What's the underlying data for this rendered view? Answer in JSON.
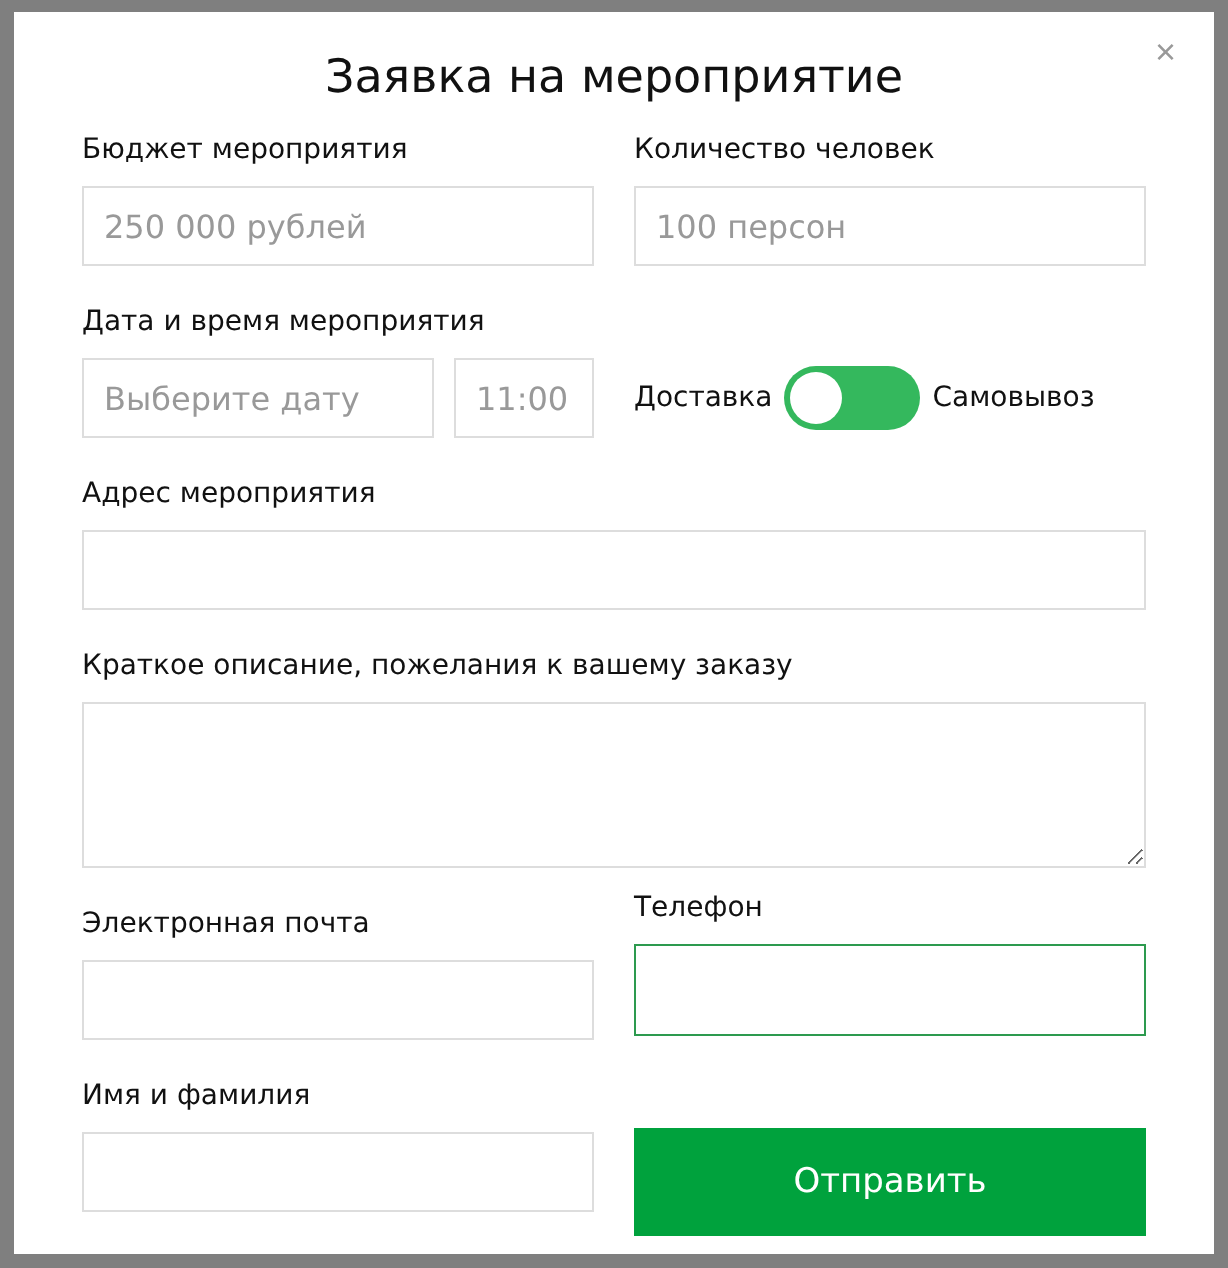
{
  "dialog": {
    "title": "Заявка на мероприятие",
    "close": "×"
  },
  "budget": {
    "label": "Бюджет мероприятия",
    "placeholder": "250 000 рублей",
    "focused": false
  },
  "people": {
    "label": "Количество человек",
    "placeholder": "100 персон",
    "focused": false
  },
  "datetime": {
    "label": "Дата и время мероприятия",
    "date_placeholder": "Выберите дату",
    "time_placeholder": "11:00"
  },
  "delivery_toggle": {
    "left_label": "Доставка",
    "right_label": "Самовывоз",
    "on": false
  },
  "address": {
    "label": "Адрес мероприятия",
    "focused": false
  },
  "description": {
    "label": "Краткое описание, пожелания к вашему заказу"
  },
  "email": {
    "label": "Электронная почта",
    "focused": false
  },
  "phone": {
    "label": "Телефон",
    "focused": true
  },
  "name": {
    "label": "Имя и фамилия",
    "focused": false
  },
  "submit": {
    "label": "Отправить"
  }
}
